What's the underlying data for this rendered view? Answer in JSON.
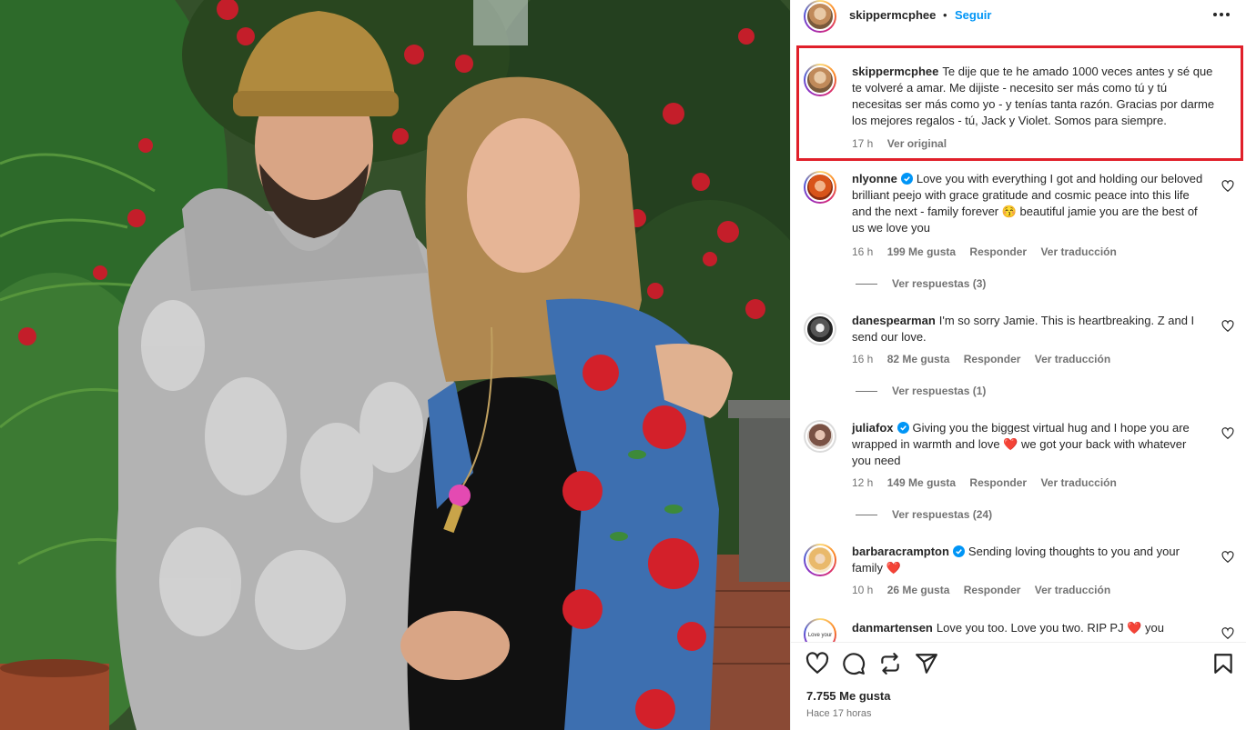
{
  "post": {
    "username": "skippermcphee",
    "separator": "•",
    "follow_label": "Seguir"
  },
  "caption": {
    "username": "skippermcphee",
    "text": "Te dije que te he amado 1000 veces antes y sé que te volveré a amar. Me dijiste - necesito ser más como tú y tú necesitas ser más como yo - y tenías tanta razón. Gracias por darme los mejores regalos - tú, Jack y Violet. Somos para siempre.",
    "time": "17 h",
    "see_original": "Ver original"
  },
  "comments": [
    {
      "username": "nlyonne",
      "verified": true,
      "text": "Love you with everything I got and holding our beloved brilliant peejo with grace gratitude and cosmic peace into this life and the next - family forever 😚 beautiful jamie you are the best of us we love you",
      "time": "16 h",
      "likes": "199 Me gusta",
      "reply": "Responder",
      "translate": "Ver traducción",
      "replies": "Ver respuestas (3)"
    },
    {
      "username": "danespearman",
      "verified": false,
      "text": "I'm so sorry Jamie. This is heartbreaking. Z and I send our love.",
      "time": "16 h",
      "likes": "82 Me gusta",
      "reply": "Responder",
      "translate": "Ver traducción",
      "replies": "Ver respuestas (1)"
    },
    {
      "username": "juliafox",
      "verified": true,
      "text": "Giving you the biggest virtual hug and I hope you are wrapped in warmth and love ❤️ we got your back with whatever you need",
      "time": "12 h",
      "likes": "149 Me gusta",
      "reply": "Responder",
      "translate": "Ver traducción",
      "replies": "Ver respuestas (24)"
    },
    {
      "username": "barbaracrampton",
      "verified": true,
      "text": "Sending loving thoughts to you and your family ❤️",
      "time": "10 h",
      "likes": "26 Me gusta",
      "reply": "Responder",
      "translate": "Ver traducción"
    },
    {
      "username": "danmartensen",
      "verified": false,
      "text": "Love you too. Love you two. RIP PJ ❤️ you",
      "avatar_text": "Love your ptyinneonr"
    }
  ],
  "footer": {
    "likes": "7.755 Me gusta",
    "time": "Hace 17 horas"
  },
  "icons": {
    "more": "more-options-icon",
    "like": "heart-icon",
    "comment": "comment-icon",
    "share": "repost-icon",
    "send": "send-icon",
    "save": "bookmark-icon",
    "verified": "verified-badge-icon"
  },
  "colors": {
    "accent": "#0095f6",
    "highlight_box": "#e0202a",
    "muted": "#737373",
    "heart": "#ed4956"
  }
}
